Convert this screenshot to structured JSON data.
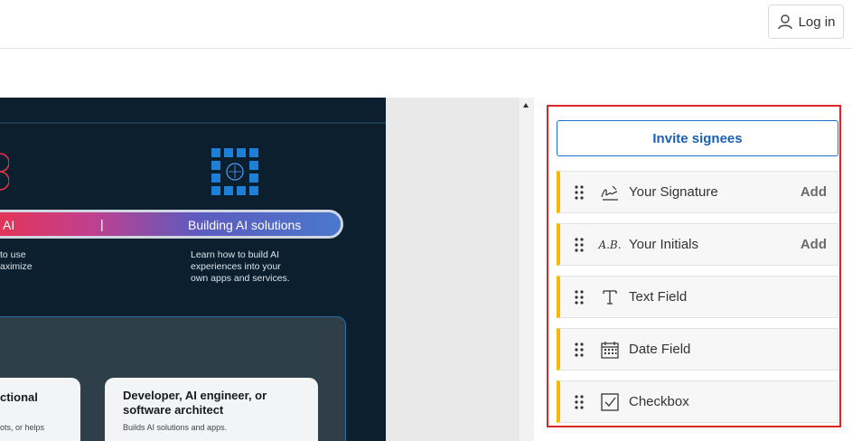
{
  "header": {
    "login_label": "Log in"
  },
  "document": {
    "pill_left": "AI",
    "pill_sep": "|",
    "pill_right": "Building AI solutions",
    "text_left": "to use\naximize",
    "text_right": "Learn how to build AI\nexperiences into your\nown apps and services.",
    "card_left_title": "ctional",
    "card_left_desc": "ots, or helps",
    "card_right_title": "Developer, AI engineer, or software architect",
    "card_right_desc": "Builds AI solutions and apps."
  },
  "sidebar": {
    "invite_label": "Invite signees",
    "fields": [
      {
        "icon": "signature-icon",
        "label": "Your Signature",
        "add": "Add"
      },
      {
        "icon": "initials-icon",
        "label": "Your Initials",
        "add": "Add",
        "icon_text": "A.B."
      },
      {
        "icon": "text-field-icon",
        "label": "Text Field"
      },
      {
        "icon": "calendar-icon",
        "label": "Date Field"
      },
      {
        "icon": "checkbox-icon",
        "label": "Checkbox"
      }
    ]
  },
  "colors": {
    "accent": "#1a5fb4",
    "field_marker": "#f6b900",
    "highlight": "#d9262d",
    "doc_bg": "#0b1f2e"
  }
}
